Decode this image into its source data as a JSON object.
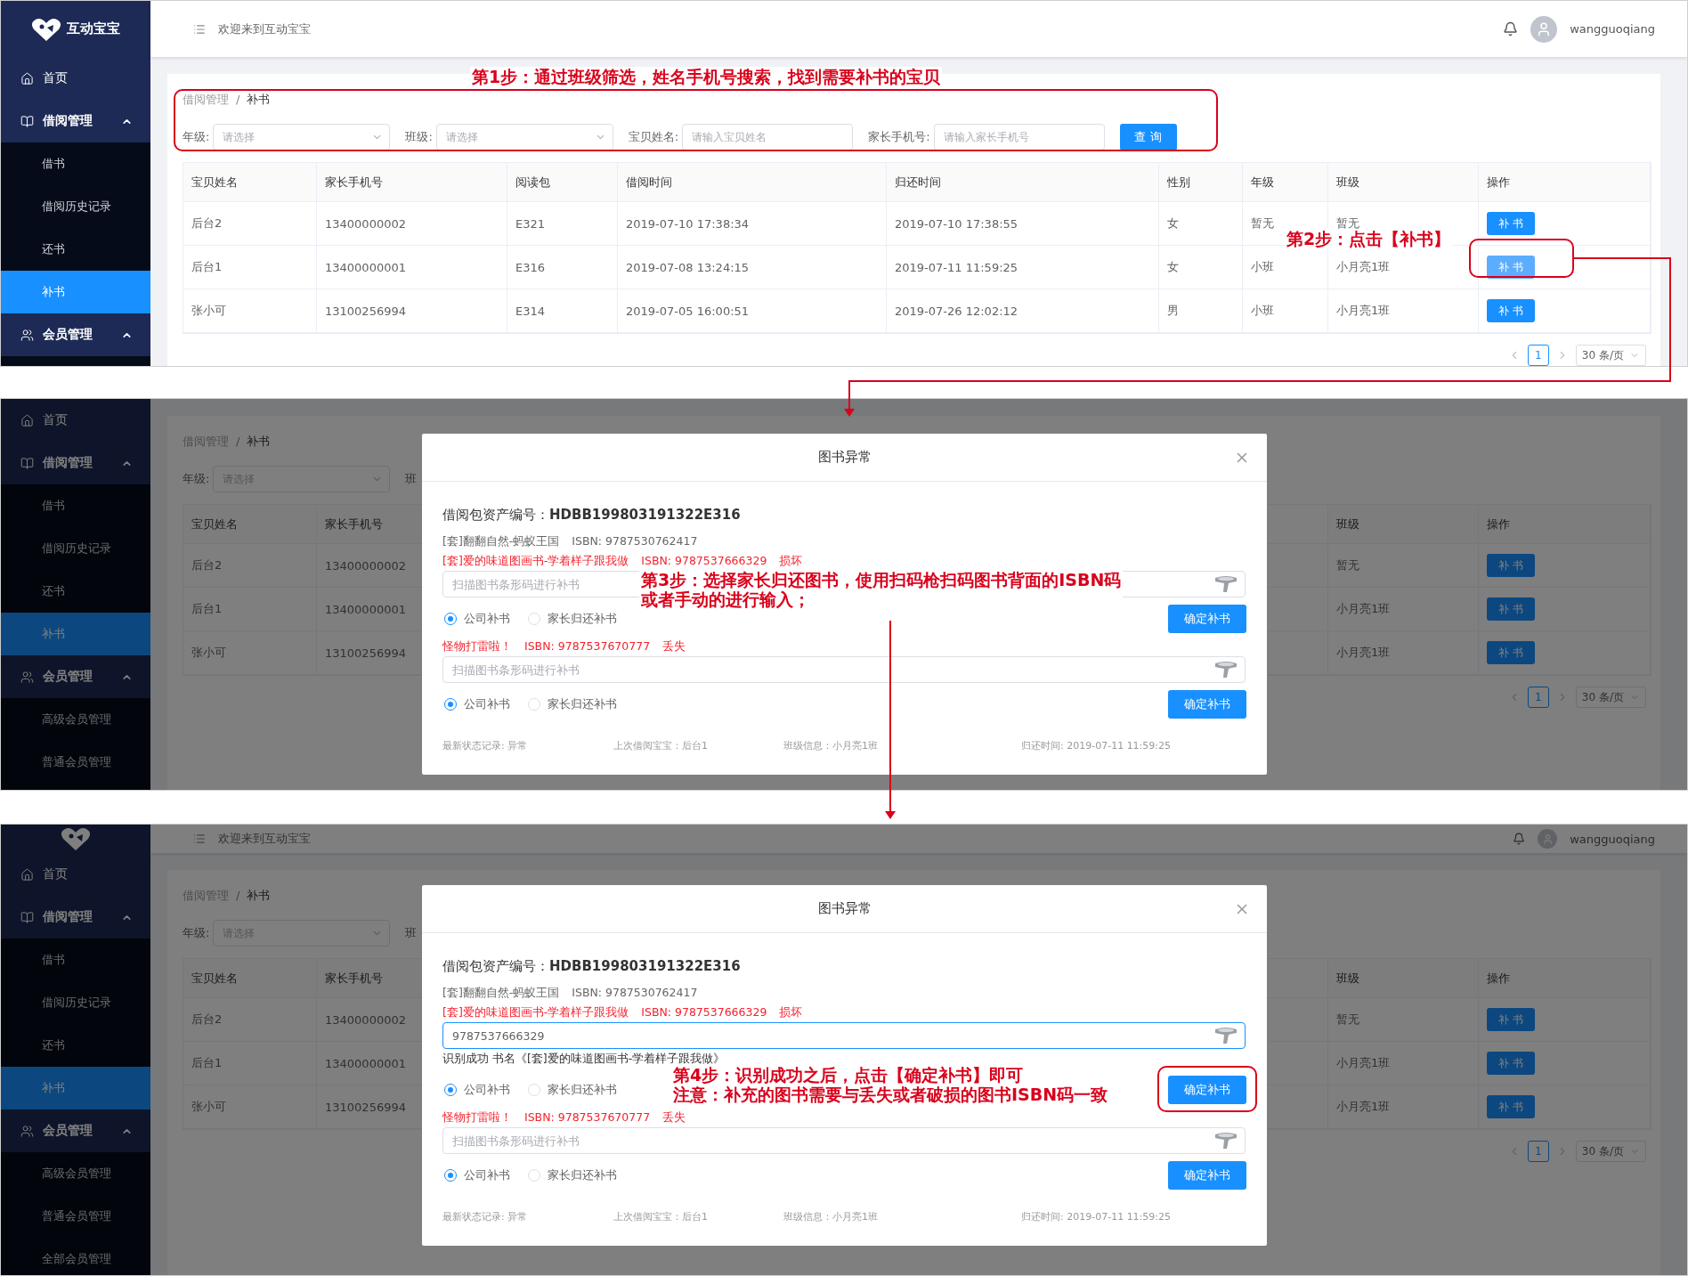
{
  "screens": [
    {
      "sidebar": {
        "logo": {
          "name": "互动宝宝"
        },
        "items": [
          {
            "label": "首页"
          },
          {
            "label": "借阅管理",
            "expanded": true,
            "children": [
              {
                "label": "借书",
                "selected": false
              },
              {
                "label": "借阅历史记录",
                "selected": false
              },
              {
                "label": "还书",
                "selected": false
              },
              {
                "label": "补书",
                "selected": true
              }
            ]
          },
          {
            "label": "会员管理",
            "expanded": true
          }
        ]
      },
      "header": {
        "welcome": "欢迎来到互动宝宝",
        "user": "wangguoqiang"
      },
      "breadcrumb": {
        "items": [
          "借阅管理",
          "补书"
        ],
        "separator": "/"
      },
      "filters": [
        {
          "kind": "select",
          "label": "年级:",
          "placeholder": "请选择"
        },
        {
          "kind": "select",
          "label": "班级:",
          "placeholder": "请选择"
        },
        {
          "kind": "input",
          "label": "宝贝姓名:",
          "placeholder": "请输入宝贝姓名"
        },
        {
          "kind": "input",
          "label": "家长手机号:",
          "placeholder": "请输入家长手机号"
        }
      ],
      "search_button": "查 询",
      "table": {
        "columns": [
          "宝贝姓名",
          "家长手机号",
          "阅读包",
          "借阅时间",
          "归还时间",
          "性别",
          "年级",
          "班级",
          "操作"
        ],
        "rows": [
          {
            "cells": [
              "后台2",
              "13400000002",
              "E321",
              "2019-07-10 17:38:34",
              "2019-07-10 17:38:55",
              "女",
              "暂无",
              "暂无"
            ],
            "action": {
              "label": "补 书",
              "highlighted": false
            }
          },
          {
            "cells": [
              "后台1",
              "13400000001",
              "E316",
              "2019-07-08 13:24:15",
              "2019-07-11 11:59:25",
              "女",
              "小班",
              "小月亮1班"
            ],
            "action": {
              "label": "补 书",
              "highlighted": true
            }
          },
          {
            "cells": [
              "张小可",
              "13100256994",
              "E314",
              "2019-07-05 16:00:51",
              "2019-07-26 12:02:12",
              "男",
              "小班",
              "小月亮1班"
            ],
            "action": {
              "label": "补 书",
              "highlighted": false
            }
          }
        ]
      },
      "pagination": {
        "current": "1",
        "page_size": "30 条/页"
      }
    },
    {
      "sidebar": {
        "items": [
          {
            "label": "首页"
          },
          {
            "label": "借阅管理",
            "expanded": true,
            "children": [
              {
                "label": "借书",
                "selected": false
              },
              {
                "label": "借阅历史记录",
                "selected": false
              },
              {
                "label": "还书",
                "selected": false
              },
              {
                "label": "补书",
                "selected": true
              }
            ]
          },
          {
            "label": "会员管理",
            "expanded": true,
            "children": [
              {
                "label": "高级会员管理",
                "selected": false
              },
              {
                "label": "普通会员管理",
                "selected": false
              }
            ]
          }
        ]
      },
      "breadcrumb": {
        "items": [
          "借阅管理",
          "补书"
        ],
        "separator": "/"
      },
      "filters": [
        {
          "kind": "select",
          "label": "年级:",
          "placeholder": "请选择"
        },
        {
          "kind": "label",
          "label": "班"
        }
      ],
      "table": {
        "columns": [
          "宝贝姓名",
          "家长手机号",
          "班级",
          "操作"
        ],
        "rows": [
          {
            "cells": [
              "后台2",
              "13400000002",
              "暂无"
            ],
            "action": {
              "label": "补 书",
              "highlighted": false
            }
          },
          {
            "cells": [
              "后台1",
              "13400000001",
              "小月亮1班"
            ],
            "action": {
              "label": "补 书",
              "highlighted": false
            }
          },
          {
            "cells": [
              "张小可",
              "13100256994",
              "小月亮1班"
            ],
            "action": {
              "label": "补 书",
              "highlighted": false
            }
          }
        ]
      },
      "pagination": {
        "current": "1",
        "page_size": "30 条/页"
      },
      "dialog": {
        "title": "图书异常",
        "asset": "借阅包资产编号：**HDBB199803191322E316**",
        "books": [
          {
            "kind": "normal",
            "title": "[套]翻翻自然-蚂蚁王国",
            "isbn": "ISBN: 9787530762417"
          },
          {
            "kind": "abnormal",
            "title": "[套]爱的味道图画书-学着样子跟我做",
            "isbn": "ISBN: 9787537666329",
            "status": "损坏",
            "scan": {
              "placeholder": "扫描图书条形码进行补书",
              "focused": false
            },
            "options": [
              {
                "label": "公司补书",
                "selected": true
              },
              {
                "label": "家长归还补书",
                "selected": false
              }
            ],
            "confirm": "确定补书"
          },
          {
            "kind": "abnormal",
            "title": "怪物打雷啦！",
            "isbn": "ISBN: 9787537670777",
            "status": "丢失",
            "scan": {
              "placeholder": "扫描图书条形码进行补书",
              "focused": false
            },
            "options": [
              {
                "label": "公司补书",
                "selected": true
              },
              {
                "label": "家长归还补书",
                "selected": false
              }
            ],
            "confirm": "确定补书"
          }
        ],
        "footer": [
          "最新状态记录: 异常",
          "上次借阅宝宝：后台1",
          "班级信息：小月亮1班",
          "归还时间: 2019-07-11 11:59:25"
        ]
      }
    },
    {
      "sidebar": {
        "items": [
          {
            "label": "首页"
          },
          {
            "label": "借阅管理",
            "expanded": true,
            "children": [
              {
                "label": "借书",
                "selected": false
              },
              {
                "label": "借阅历史记录",
                "selected": false
              },
              {
                "label": "还书",
                "selected": false
              },
              {
                "label": "补书",
                "selected": true
              }
            ]
          },
          {
            "label": "会员管理",
            "expanded": true,
            "children": [
              {
                "label": "高级会员管理",
                "selected": false
              },
              {
                "label": "普通会员管理",
                "selected": false
              },
              {
                "label": "全部会员管理",
                "selected": false
              }
            ]
          }
        ]
      },
      "header": {
        "welcome": "欢迎来到互动宝宝",
        "user": "wangguoqiang"
      },
      "breadcrumb": {
        "items": [
          "借阅管理",
          "补书"
        ],
        "separator": "/"
      },
      "filters": [
        {
          "kind": "select",
          "label": "年级:",
          "placeholder": "请选择"
        },
        {
          "kind": "label",
          "label": "班"
        }
      ],
      "table": {
        "columns": [
          "宝贝姓名",
          "家长手机号",
          "班级",
          "操作"
        ],
        "rows": [
          {
            "cells": [
              "后台2",
              "13400000002",
              "暂无"
            ],
            "action": {
              "label": "补 书",
              "highlighted": false
            }
          },
          {
            "cells": [
              "后台1",
              "13400000001",
              "小月亮1班"
            ],
            "action": {
              "label": "补 书",
              "highlighted": false
            }
          },
          {
            "cells": [
              "张小可",
              "13100256994",
              "小月亮1班"
            ],
            "action": {
              "label": "补 书",
              "highlighted": false
            }
          }
        ]
      },
      "pagination": {
        "current": "1",
        "page_size": "30 条/页"
      },
      "dialog": {
        "title": "图书异常",
        "asset": "借阅包资产编号：**HDBB199803191322E316**",
        "books": [
          {
            "kind": "normal",
            "title": "[套]翻翻自然-蚂蚁王国",
            "isbn": "ISBN: 9787530762417"
          },
          {
            "kind": "abnormal",
            "title": "[套]爱的味道图画书-学着样子跟我做",
            "isbn": "ISBN: 9787537666329",
            "status": "损坏",
            "scan": {
              "value": "9787537666329",
              "focused": true
            },
            "result": "识别成功 书名《[套]爱的味道图画书-学着样子跟我做》",
            "options": [
              {
                "label": "公司补书",
                "selected": true
              },
              {
                "label": "家长归还补书",
                "selected": false
              }
            ],
            "confirm": "确定补书"
          },
          {
            "kind": "abnormal",
            "title": "怪物打雷啦！",
            "isbn": "ISBN: 9787537670777",
            "status": "丢失",
            "scan": {
              "placeholder": "扫描图书条形码进行补书",
              "focused": false
            },
            "options": [
              {
                "label": "公司补书",
                "selected": true
              },
              {
                "label": "家长归还补书",
                "selected": false
              }
            ],
            "confirm": "确定补书"
          }
        ],
        "footer": [
          "最新状态记录: 异常",
          "上次借阅宝宝：后台1",
          "班级信息：小月亮1班",
          "归还时间: 2019-07-11 11:59:25"
        ]
      }
    }
  ],
  "annotations": [
    {
      "lines": [
        "第1步：通过班级筛选，姓名手机号搜索，找到需要补书的宝贝"
      ]
    },
    {
      "lines": [
        "第2步：点击【补书】"
      ]
    },
    {
      "lines": [
        "第3步：选择家长归还图书，使用扫码枪扫码图书背面的ISBN码",
        "或者手动的进行输入；"
      ]
    },
    {
      "lines": [
        "第4步：识别成功之后，点击【确定补书】即可",
        "注意：补充的图书需要与丢失或者破损的图书ISBN码一致"
      ]
    }
  ]
}
